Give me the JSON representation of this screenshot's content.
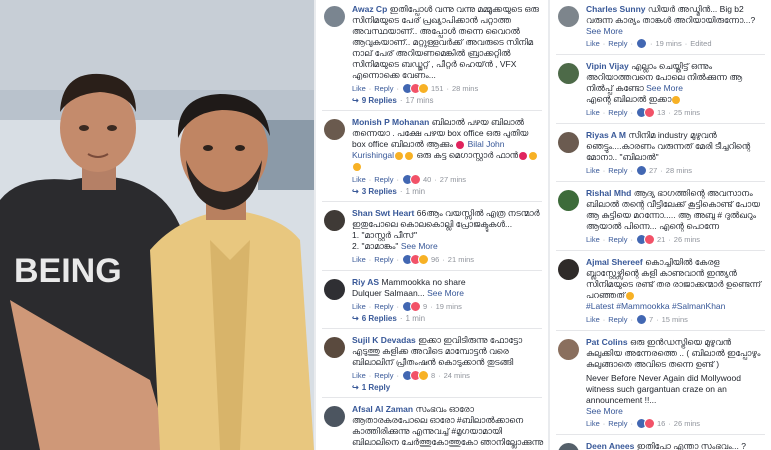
{
  "photo_text": "BEING",
  "mid_comments": [
    {
      "name": "Awaz Cp",
      "text": "ഇതിപ്പോൾ വന്നു വന്നു മമ്മൂക്കയുടെ ഒരു സിനിമയുടെ പേര് പ്രഖ്യാപിക്കാൻ പറ്റാത്ത അവസ്ഥയാണ്.. അപ്പോൾ തന്നെ വൈറൽ ആവുകയാണ്.. മറ്റുള്ളവർക്ക് അവരുടെ സിനിമ നാല് പേര് അറിയണമെങ്കിൽ ബ്രാക്കറ്റിൽ സിനിമയുടെ ബഡ്ജറ്റ് , പീറ്റർ ഹെയ്ൻ , VFX എന്നൊക്കെ വേണം...",
      "like": "Like",
      "reply": "Reply",
      "reactions": "151",
      "time": "28 mins",
      "replies": "9 Replies",
      "replies_time": "17 mins"
    },
    {
      "name": "Monish P Mohanan",
      "text": "ബിലാൽ പഴയ ബിലാൽ തന്നെയാ . പക്ഷേ പഴയ box office ഒരു പുതിയ box office ബിലാൽ ആക്കും ",
      "text2": "Bilal John Kurishingal",
      "text3": "ഒരു കട്ട മെഗാസ്റ്റാർ ഫാൻ",
      "like": "Like",
      "reply": "Reply",
      "reactions": "40",
      "time": "27 mins",
      "replies": "3 Replies",
      "replies_time": "1 min"
    },
    {
      "name": "Shan Swt Heart",
      "text": "66ആം വയസ്സിൽ എത്ര നടന്മാർ ഇതുപോലെ കൊലകൊല്ലി പ്രോജക്ടുകൾ...",
      "list1": "1. \"മാസ്റ്റർ പീസ്\"",
      "list2": "2. \"മാമാങ്കം\"",
      "more": "See More",
      "like": "Like",
      "reply": "Reply",
      "reactions": "96",
      "time": "21 mins"
    },
    {
      "name": "Riy AS",
      "text": "Mammookka no share",
      "text2": "Dulquer Salmaan...",
      "more": "See More",
      "like": "Like",
      "reply": "Reply",
      "reactions": "9",
      "time": "19 mins",
      "replies": "6 Replies",
      "replies_time": "1 min"
    },
    {
      "name": "Sujil K Devadas",
      "text": "ഇക്കാ ഇവിടിരുന്നു ഫോട്ടോ എടുത്തു കളിക്ക അവിടെ മാമ്പോട്ടൻ വരെ ബിലാലിന് പ്രീതംഷൻ കൊടുക്കാൻ തുടങ്ങി",
      "like": "Like",
      "reply": "Reply",
      "reactions": "8",
      "time": "24 mins",
      "replies": "1 Reply"
    },
    {
      "name": "Afsal Al Zaman",
      "text": "സംഭവം ഓരോ ആതാരകരപോലെ ഓരോ #ബിലാൽക്കാനെ കാത്തിരിക്കുന്നു എന്നുവച്ച് #മൃഗയാമായി ബിലാലിനെ ചേർത്തുകോത്തുകോ ഞാനില്ലോക്കുന്നു"
    }
  ],
  "right_comments": [
    {
      "name": "Charles Sunny",
      "text": "ഡിയർ അഡ്മിൻ... Big b2 വരുന്ന കാര്യം താങ്കൾ അറിയായിരുന്നോ...?",
      "more": "See More",
      "like": "Like",
      "reply": "Reply",
      "reactions": "",
      "time": "19 mins",
      "extra": "Edited"
    },
    {
      "name": "Vipin Vijay",
      "text": "എല്ലാം ചെയ്തിട്ട് ഒന്നും അറിയാത്തവനെ പോലെ നിൽക്കുന്ന ആ നിൽപ്പ് കണ്ടോ",
      "text2": "എന്റെ ബിലാൽ ഇക്കാ",
      "more": "See More",
      "like": "Like",
      "reply": "Reply",
      "reactions": "13",
      "time": "25 mins"
    },
    {
      "name": "Riyas A M",
      "text": "സിനിമ industry മുഴുവൻ ഞെട്ടും....കാരണം വരുന്നത് മേരി ടീച്ചറിന്റെ മോനാ.. \"ബിലാൽ\"",
      "like": "Like",
      "reply": "Reply",
      "reactions": "27",
      "time": "28 mins"
    },
    {
      "name": "Rishal Mhd",
      "text": "ആദ്യ ഭാഗത്തിന്റെ അവസാനം ബിലാൽ തന്റെ വീട്ടിലേക്ക് കൂട്ടികൊണ്ട് പോയ ആ കുട്ടിയെ മറന്നോ..... ആ അബു # ദുൽഖറും ആയാൽ പിന്നെ... എന്റെ പൊന്നേ",
      "like": "Like",
      "reply": "Reply",
      "reactions": "21",
      "time": "26 mins"
    },
    {
      "name": "Ajmal Shereef",
      "text": "കൊച്ചിയിൽ കേരള ബ്ലാസ്റ്റേഴ്സിന്റെ കളി കാണുവാൻ ഇന്ത്യൻ സിനിമയുടെ രണ്ട് തര രാജാക്കന്മാർ ഉണ്ടെന്ന് പറഞ്ഞത്",
      "tags": "#Latest #Mammookka #SalmanKhan",
      "like": "Like",
      "reply": "Reply",
      "reactions": "7",
      "time": "15 mins"
    },
    {
      "name": "Pat Colins",
      "text": "ഒരു ഇൻഡസ്ട്രിയെ മുഴുവൻ കുലുക്കിയ അന്നേരത്തെ .. ( ബിലാൽ ഇപ്പോഴും കുലുങ്ങാതെ അവിടെ തന്നെ ഉണ്ട് )",
      "text2": "Never Before Never Again did Mollywood witness such gargantuan craze on an announcement !!...",
      "more": "See More",
      "like": "Like",
      "reply": "Reply",
      "reactions": "16",
      "time": "26 mins"
    },
    {
      "name": "Deen Anees",
      "text": "ഇതിപ്പോ എന്താ സംഭവം... ? എന്റെ ഇക്ക നമ്മളെ വെറുതെ ഇരിക്കാൻ"
    }
  ]
}
